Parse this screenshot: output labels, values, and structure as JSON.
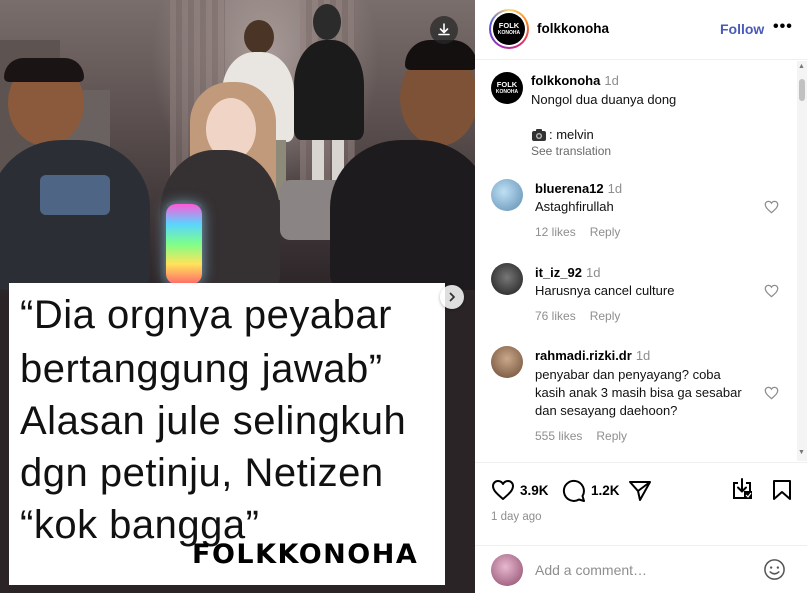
{
  "media": {
    "caption_lines": [
      "“Dia orgnya peyabar",
      "bertanggung jawab”",
      "Alasan jule selingkuh",
      "dgn petinju, Netizen",
      "“kok bangga”"
    ],
    "brand_watermark": "FOLKKONOHA",
    "download_icon": "download-icon",
    "next_icon": "chevron-right-icon"
  },
  "header": {
    "avatar_text_1": "FOLK",
    "avatar_text_2": "KONOHA",
    "username": "folkkonoha",
    "follow_label": "Follow",
    "more_label": "•••"
  },
  "caption": {
    "username": "folkkonoha",
    "time": "1d",
    "text": "Nongol dua duanya dong",
    "credit": ": melvin",
    "credit_icon": "camera-icon",
    "see_translation": "See translation"
  },
  "comments": [
    {
      "username": "bluerena12",
      "time": "1d",
      "text": "Astaghfirullah",
      "likes": "12 likes",
      "reply": "Reply"
    },
    {
      "username": "it_iz_92",
      "time": "1d",
      "text": "Harusnya cancel culture",
      "likes": "76 likes",
      "reply": "Reply"
    },
    {
      "username": "rahmadi.rizki.dr",
      "time": "1d",
      "text_lines": [
        "penyabar dan penyayang? coba",
        "kasih anak 3 masih bisa ga sesabar",
        "dan sesayang daehoon?"
      ],
      "likes": "555 likes",
      "reply": "Reply"
    }
  ],
  "actions": {
    "like_count": "3.9K",
    "comment_count": "1.2K",
    "post_time": "1 day ago",
    "icons": [
      "heart-icon",
      "comment-icon",
      "share-icon",
      "save-download-icon",
      "bookmark-icon"
    ]
  },
  "add_comment": {
    "placeholder": "Add a comment…",
    "emoji_icon": "emoji-icon"
  },
  "colors": {
    "follow_blue": "#4a5ab8",
    "muted_gray": "#8e8e8e",
    "border": "#efefef"
  }
}
